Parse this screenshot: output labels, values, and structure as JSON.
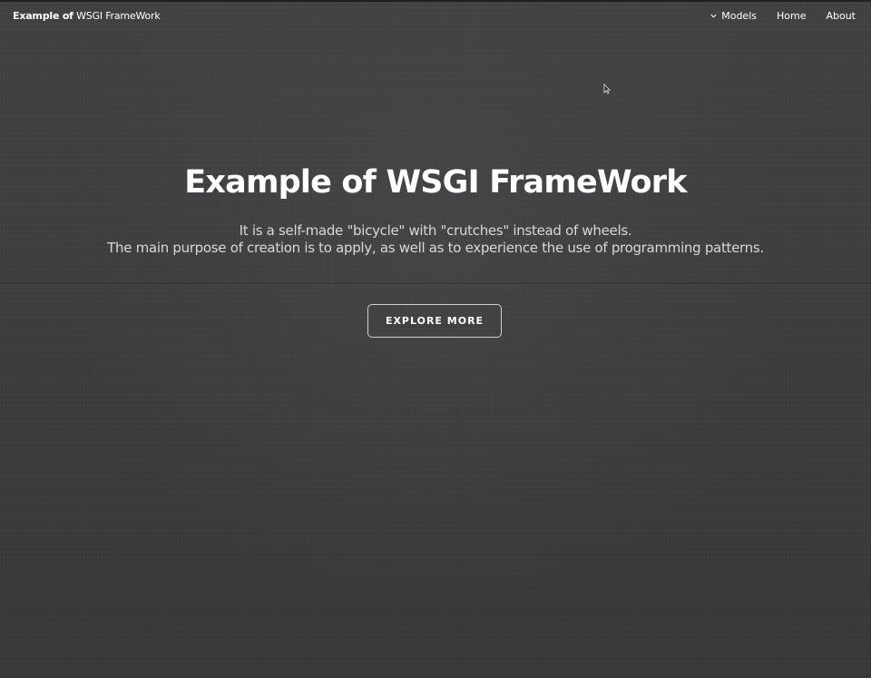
{
  "navbar": {
    "brand_bold": "Example of",
    "brand_rest": " WSGI FrameWork",
    "links": [
      {
        "label": "Models",
        "icon": "chevron-down-icon"
      },
      {
        "label": "Home"
      },
      {
        "label": "About"
      }
    ]
  },
  "hero": {
    "title": "Example of WSGI FrameWork",
    "subtitle_line1": "It is a self-made \"bicycle\" with \"crutches\" instead of wheels.",
    "subtitle_line2": "The main purpose of creation is to apply, as well as to experience the use of programming patterns.",
    "button_label": "EXPLORE MORE"
  },
  "colors": {
    "background": "#3d3d3f",
    "text": "#ffffff",
    "subtitle_text": "#d8d8d8"
  }
}
